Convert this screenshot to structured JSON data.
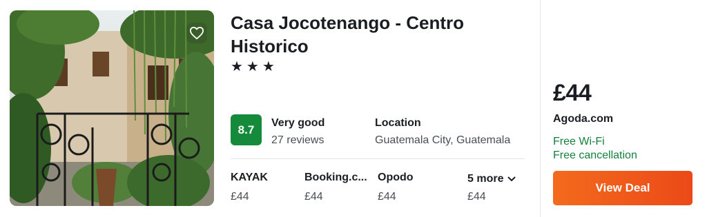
{
  "hotel": {
    "name": "Casa Jocotenango - Centro Historico",
    "stars": "★★★",
    "star_count": 3,
    "score": "8.7",
    "rating_word": "Very good",
    "reviews": "27 reviews",
    "location_label": "Location",
    "location_value": "Guatemala City, Guatemala"
  },
  "providers": [
    {
      "name": "KAYAK",
      "price": "£44"
    },
    {
      "name": "Booking.c...",
      "price": "£44"
    },
    {
      "name": "Opodo",
      "price": "£44"
    }
  ],
  "more": {
    "label": "5 more",
    "price": "£44"
  },
  "deal": {
    "price": "£44",
    "site": "Agoda.com",
    "features": [
      "Free Wi-Fi",
      "Free cancellation"
    ],
    "button_label": "View Deal"
  },
  "icons": {
    "favorite": "heart-outline-icon",
    "more": "chevron-down-icon"
  },
  "colors": {
    "score_badge": "#158a3a",
    "feature_text": "#15803d",
    "deal_button": "#f05a1b"
  }
}
